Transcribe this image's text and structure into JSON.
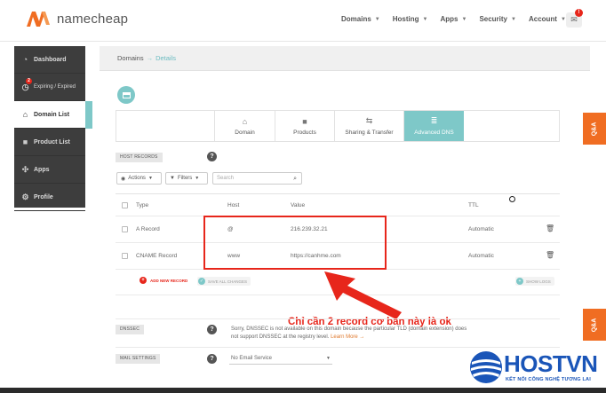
{
  "brand": {
    "name": "namecheap",
    "accent": "#f06d22",
    "teal": "#7ec8c8"
  },
  "topnav": [
    {
      "label": "Domains"
    },
    {
      "label": "Hosting"
    },
    {
      "label": "Apps"
    },
    {
      "label": "Security"
    },
    {
      "label": "Account"
    }
  ],
  "notifications": {
    "count": "!"
  },
  "sidebar": {
    "items": [
      {
        "label": "Dashboard",
        "icon": "dashboard-icon"
      },
      {
        "label": "Expiring / Expired",
        "icon": "timer-icon",
        "badge": "2"
      },
      {
        "label": "Domain List",
        "icon": "home-icon"
      },
      {
        "label": "Product List",
        "icon": "cube-icon"
      },
      {
        "label": "Apps",
        "icon": "apps-icon"
      },
      {
        "label": "Profile",
        "icon": "gear-icon"
      }
    ]
  },
  "breadcrumb": {
    "parent": "Domains",
    "separator": "→",
    "current": "Details"
  },
  "tabs": [
    {
      "label": "Domain",
      "icon": "home-icon"
    },
    {
      "label": "Products",
      "icon": "cube-icon"
    },
    {
      "label": "Sharing & Transfer",
      "icon": "share-icon"
    },
    {
      "label": "Advanced DNS",
      "icon": "server-icon"
    }
  ],
  "host_records": {
    "section_label": "HOST RECORDS",
    "help": "?",
    "actions_label": "Actions",
    "filters_label": "Filters",
    "search_placeholder": "Search",
    "columns": {
      "type": "Type",
      "host": "Host",
      "value": "Value",
      "ttl": "TTL"
    },
    "rows": [
      {
        "type": "A Record",
        "host": "@",
        "value": "216.239.32.21",
        "ttl": "Automatic"
      },
      {
        "type": "CNAME Record",
        "host": "www",
        "value": "https://canhme.com",
        "ttl": "Automatic"
      }
    ],
    "add_label": "ADD NEW RECORD",
    "save_label": "SAVE ALL CHANGES",
    "logs_label": "SHOW LOGS"
  },
  "annotation": {
    "text": "Chỉ cần 2 record cơ bản này là ok"
  },
  "dnssec": {
    "section_label": "DNSSEC",
    "help": "?",
    "text_line1": "Sorry, DNSSEC is not available on this domain because the particular TLD (domain extension) does",
    "text_line2": "not support DNSSEC at the registry level.",
    "link": "Learn More →"
  },
  "mail_settings": {
    "section_label": "MAIL SETTINGS",
    "help": "?",
    "selected": "No Email Service"
  },
  "qa_tab": {
    "label": "Q&A"
  },
  "watermark": {
    "name": "HOSTVN",
    "tagline": "KẾT NỐI CÔNG NGHỆ TƯƠNG LAI"
  }
}
